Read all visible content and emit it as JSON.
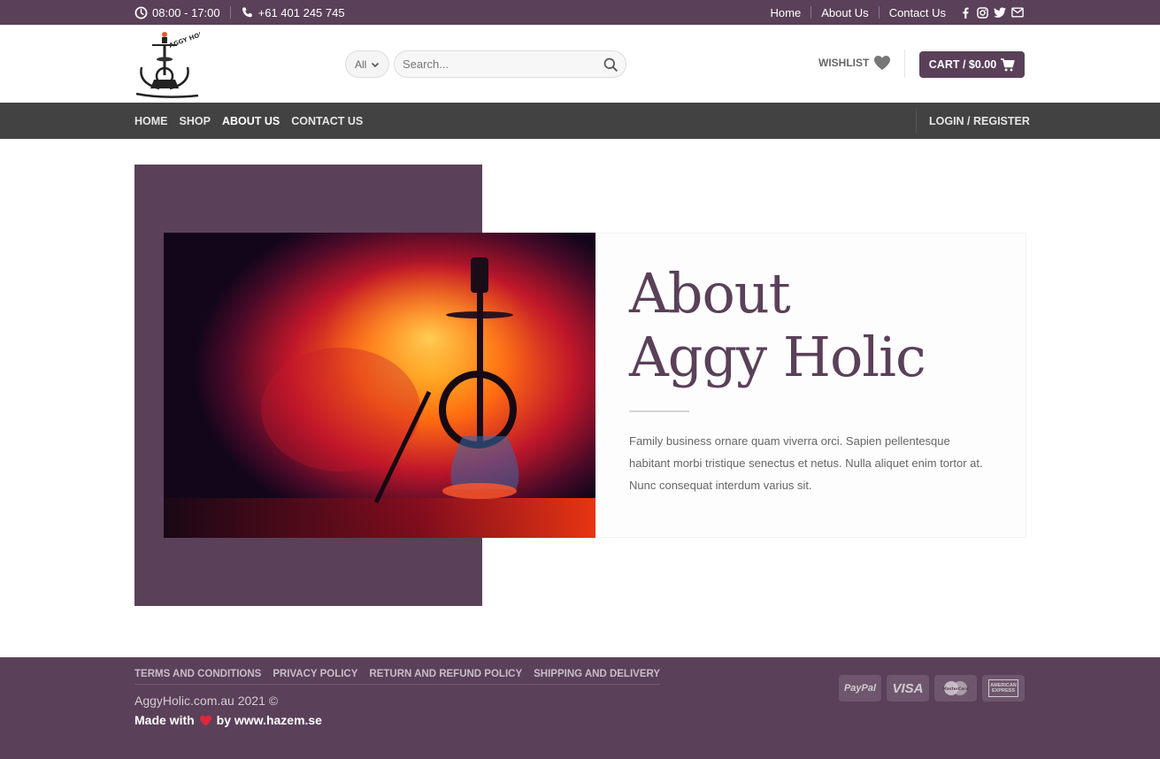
{
  "topbar": {
    "hours": "08:00 - 17:00",
    "phone": "+61 401 245 745",
    "links": [
      "Home",
      "About Us",
      "Contact Us"
    ],
    "social_icons": [
      "facebook-icon",
      "instagram-icon",
      "twitter-icon",
      "email-icon"
    ]
  },
  "header": {
    "logo_text": "AGGY HOLIC",
    "category_select": "All",
    "search_placeholder": "Search...",
    "wishlist_label": "WISHLIST",
    "cart_label": "CART / $0.00"
  },
  "nav": {
    "items": [
      "HOME",
      "SHOP",
      "ABOUT US",
      "CONTACT US"
    ],
    "active": "ABOUT US",
    "login": "LOGIN / REGISTER"
  },
  "about": {
    "title_line1": "About",
    "title_line2": "Aggy Holic",
    "body": "Family business  ornare quam viverra orci. Sapien pellentesque habitant morbi tristique senectus et netus. Nulla aliquet enim tortor at. Nunc consequat interdum varius sit."
  },
  "footer": {
    "links": [
      "TERMS AND CONDITIONS",
      "PRIVACY POLICY",
      "RETURN AND REFUND POLICY",
      "SHIPPING AND DELIVERY"
    ],
    "copyright": "AggyHolic.com.au 2021 ©",
    "made_with_prefix": "Made with",
    "made_with_suffix": "by www.hazem.se",
    "payments": [
      "PayPal",
      "VISA",
      "MasterCard",
      "AMERICAN EXPRESS"
    ]
  },
  "colors": {
    "brand": "#5a4059",
    "nav": "#424242"
  }
}
